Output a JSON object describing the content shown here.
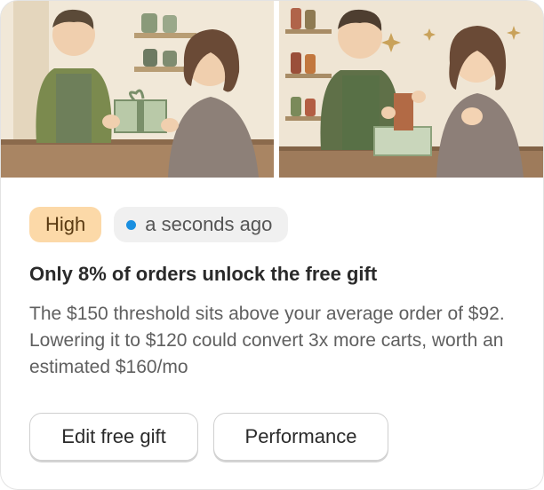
{
  "badge": {
    "priority": "High",
    "time": "a seconds ago",
    "priority_color": "#fcd9a8",
    "status_dot_color": "#1a8fe0"
  },
  "insight": {
    "title": "Only 8% of orders unlock the free gift",
    "body": "The $150 threshold sits above your average order of $92. Lowering it to $120 could convert 3x more carts, worth an estimated $160/mo"
  },
  "actions": {
    "edit_label": "Edit free gift",
    "performance_label": "Performance"
  }
}
